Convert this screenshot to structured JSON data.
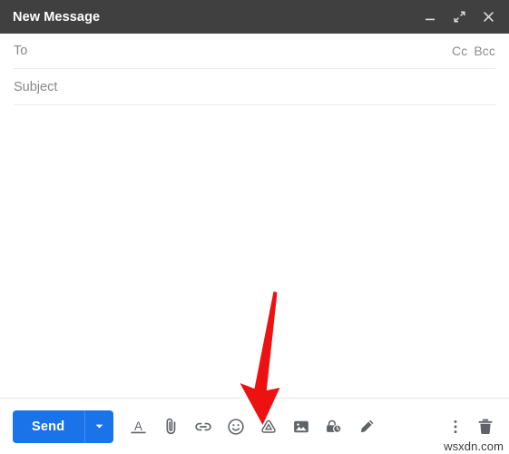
{
  "window": {
    "title": "New Message",
    "header_bg": "#404040",
    "controls": [
      {
        "name": "minimize",
        "label": "Minimize"
      },
      {
        "name": "expand",
        "label": "Full screen"
      },
      {
        "name": "close",
        "label": "Save & close"
      }
    ]
  },
  "fields": {
    "to": {
      "label": "To",
      "value": "",
      "placeholder": "To"
    },
    "cc": "Cc",
    "bcc": "Bcc",
    "subject": {
      "label": "Subject",
      "value": "",
      "placeholder": "Subject"
    }
  },
  "body": {
    "value": "",
    "placeholder": ""
  },
  "toolbar": {
    "send_label": "Send",
    "send_color": "#1a73e8",
    "send_dropdown_icon": "chevron-down-icon",
    "icons": [
      {
        "name": "formatting-options-icon",
        "label": "Formatting options"
      },
      {
        "name": "attach-file-icon",
        "label": "Attach files"
      },
      {
        "name": "insert-link-icon",
        "label": "Insert link"
      },
      {
        "name": "insert-emoji-icon",
        "label": "Insert emoji"
      },
      {
        "name": "insert-drive-icon",
        "label": "Insert files using Drive"
      },
      {
        "name": "insert-photo-icon",
        "label": "Insert photo"
      },
      {
        "name": "confidential-mode-icon",
        "label": "Toggle confidential mode"
      },
      {
        "name": "insert-signature-icon",
        "label": "Insert signature"
      }
    ],
    "right_icons": [
      {
        "name": "more-options-icon",
        "label": "More options"
      },
      {
        "name": "discard-draft-icon",
        "label": "Discard draft"
      }
    ]
  },
  "annotation": {
    "arrow_color": "#ee1111",
    "points_at": "insert-drive-icon"
  },
  "watermark": {
    "text": "wsxdn.com"
  }
}
